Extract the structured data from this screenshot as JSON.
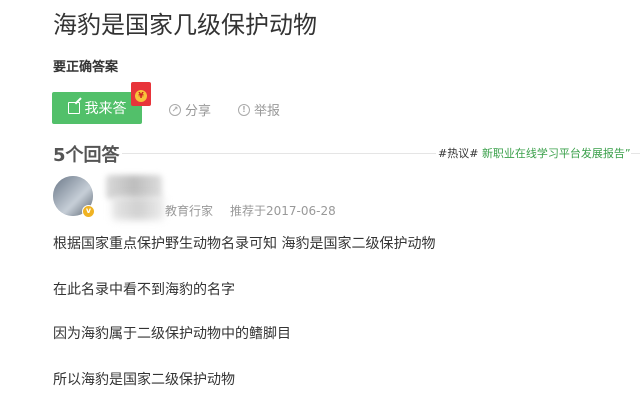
{
  "question": {
    "title": "海豹是国家几级保护动物",
    "subtitle": "要正确答案"
  },
  "actions": {
    "answer_label": "我来答",
    "share_label": "分享",
    "report_label": "举报"
  },
  "answers": {
    "count_label": "5个回答"
  },
  "hot_topic": {
    "tag": "#热议#",
    "link": "新职业在线学习平台发展报告”"
  },
  "answer": {
    "category": "教育行家",
    "recommended": "推荐于2017-06-28",
    "lines": [
      "根据国家重点保护野生动物名录可知 海豹是国家二级保护动物",
      "在此名录中看不到海豹的名字",
      "因为海豹属于二级保护动物中的鳍脚目",
      "所以海豹是国家二级保护动物"
    ]
  },
  "colors": {
    "accent": "#52c06a",
    "link": "#3aa04a",
    "muted": "#999999"
  }
}
